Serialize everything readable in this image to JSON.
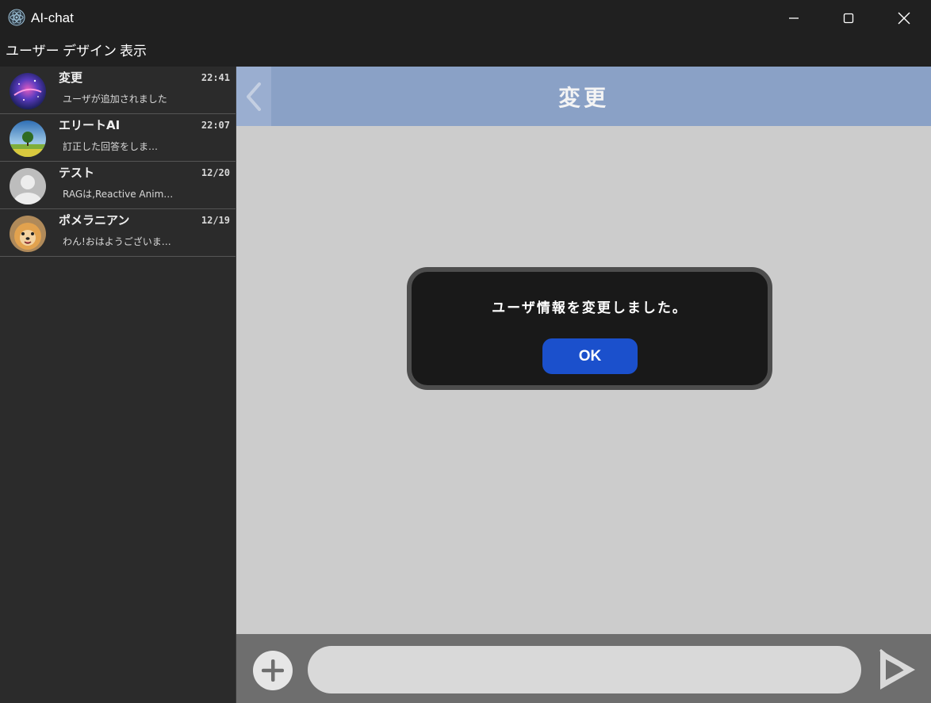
{
  "window": {
    "title": "AI-chat",
    "icons": {
      "app": "electron-atom-icon",
      "minimize": "minimize-icon",
      "maximize": "maximize-icon",
      "close": "close-icon"
    }
  },
  "menu": {
    "items": [
      "ユーザー",
      "デザイン",
      "表示"
    ]
  },
  "sidebar": {
    "chats": [
      {
        "name": "変更",
        "time": "22:41",
        "preview": "ユーザが追加されました",
        "avatar": "galaxy-avatar"
      },
      {
        "name": "エリートAI",
        "time": "22:07",
        "preview": "訂正した回答をしま…",
        "avatar": "tree-field-avatar"
      },
      {
        "name": "テスト",
        "time": "12/20",
        "preview": "RAGは,Reactive Anim…",
        "avatar": "default-person-avatar"
      },
      {
        "name": "ポメラニアン",
        "time": "12/19",
        "preview": "わん!おはようございま…",
        "avatar": "pomeranian-avatar"
      }
    ]
  },
  "main": {
    "header_title": "変更",
    "back_icon": "chevron-left-icon"
  },
  "dialog": {
    "message": "ユーザ情報を変更しました。",
    "ok_label": "OK"
  },
  "input": {
    "value": "",
    "placeholder": "",
    "attach_icon": "plus-circle-icon",
    "send_icon": "send-play-icon"
  },
  "colors": {
    "header": "#8aa1c6",
    "ok_button": "#1b50cc",
    "sidebar": "#2b2b2b",
    "chat_area": "#cccccc",
    "input_bar": "#6e6e6e"
  }
}
